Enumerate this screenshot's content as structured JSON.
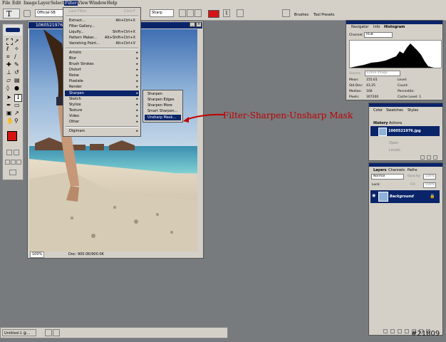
{
  "menubar": {
    "items": [
      "File",
      "Edit",
      "Image",
      "Layer",
      "Select",
      "Filter",
      "View",
      "Window",
      "Help"
    ]
  },
  "options_bar": {
    "font_family": "Official-SB",
    "aa_mode": "Sharp"
  },
  "document": {
    "title": "1060521976.jpg",
    "zoom": "100%",
    "doc_size": "Doc: 900.0K/900.0K"
  },
  "filter_menu": {
    "items": [
      {
        "label": "Last Filter",
        "shortcut": "Ctrl+F",
        "disabled": true
      },
      {
        "label": "Extract...",
        "shortcut": "Alt+Ctrl+X"
      },
      {
        "label": "Filter Gallery..."
      },
      {
        "label": "Liquify...",
        "shortcut": "Shift+Ctrl+X"
      },
      {
        "label": "Pattern Maker...",
        "shortcut": "Alt+Shift+Ctrl+X"
      },
      {
        "label": "Vanishing Point...",
        "shortcut": "Alt+Ctrl+V"
      },
      {
        "label": "Artistic",
        "sub": true
      },
      {
        "label": "Blur",
        "sub": true
      },
      {
        "label": "Brush Strokes",
        "sub": true
      },
      {
        "label": "Distort",
        "sub": true
      },
      {
        "label": "Noise",
        "sub": true
      },
      {
        "label": "Pixelate",
        "sub": true
      },
      {
        "label": "Render",
        "sub": true
      },
      {
        "label": "Sharpen",
        "sub": true,
        "active": true
      },
      {
        "label": "Sketch",
        "sub": true
      },
      {
        "label": "Stylize",
        "sub": true
      },
      {
        "label": "Texture",
        "sub": true
      },
      {
        "label": "Video",
        "sub": true
      },
      {
        "label": "Other",
        "sub": true
      },
      {
        "label": "Digimarc",
        "sub": true
      }
    ]
  },
  "sharpen_submenu": {
    "items": [
      "Sharpen",
      "Sharpen Edges",
      "Sharpen More",
      "Smart Sharpen...",
      "Unsharp Mask..."
    ],
    "active_index": 4
  },
  "annotation": {
    "text": "Filter-Sharpen-Unsharp Mask",
    "color": "#c00000"
  },
  "top_tabs": {
    "brushes": "Brushes",
    "tool_presets": "Tool Presets"
  },
  "histogram_panel": {
    "tabs": [
      "Navigator",
      "Info",
      "Histogram"
    ],
    "channel_label": "Channel:",
    "channel_value": "RGB",
    "source_label": "Source:",
    "source_value": "Entire Image",
    "stats": [
      {
        "label": "Mean:",
        "value": "155.61"
      },
      {
        "label": "Std Dev:",
        "value": "43.25"
      },
      {
        "label": "Median:",
        "value": "166"
      },
      {
        "label": "Pixels:",
        "value": "307200"
      }
    ],
    "stats_right": [
      "Level:",
      "Count:",
      "Percentile:",
      "Cache Level: 1"
    ]
  },
  "history_panel": {
    "tabs": [
      "Color",
      "Swatches",
      "Styles"
    ],
    "sub_tabs": [
      "History",
      "Actions"
    ],
    "snapshot": "1060521976.jpg",
    "steps": [
      "Open",
      "Levels"
    ]
  },
  "layers_panel": {
    "tabs": [
      "Layers",
      "Channels",
      "Paths"
    ],
    "blend_mode": "Normal",
    "opacity_label": "Opacity:",
    "opacity_value": "100%",
    "lock_label": "Lock:",
    "fill_label": "Fill:",
    "fill_value": "100%",
    "layer_name": "Background"
  },
  "taskbar": {
    "label": "Untitled-1 @..."
  },
  "watermark": "#21809",
  "colors": {
    "foreground": "#d41414",
    "background": "#ffffff",
    "selection": "#0a246a"
  }
}
